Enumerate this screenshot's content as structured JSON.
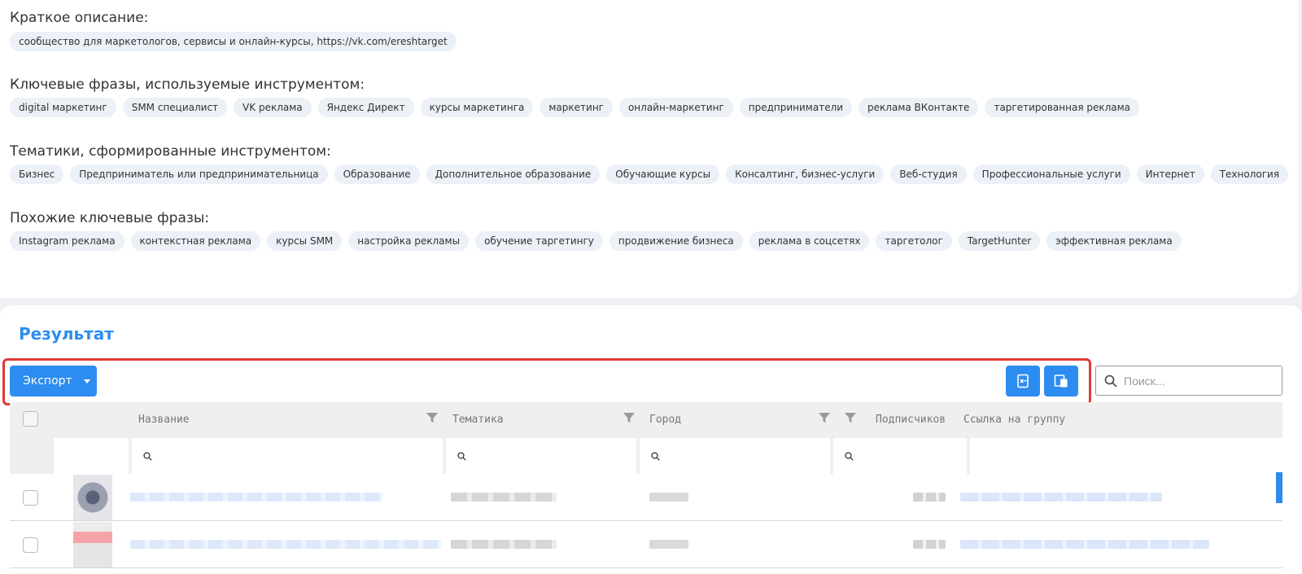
{
  "description": {
    "title": "Краткое описание:",
    "chips": [
      "сообщество для маркетологов, сервисы и онлайн-курсы, https://vk.com/ereshtarget"
    ]
  },
  "keywords": {
    "title": "Ключевые фразы, используемые инструментом:",
    "chips": [
      "digital маркетинг",
      "SMM специалист",
      "VK реклама",
      "Яндекс Директ",
      "курсы маркетинга",
      "маркетинг",
      "онлайн-маркетинг",
      "предприниматели",
      "реклама ВКонтакте",
      "таргетированная реклама"
    ]
  },
  "topics": {
    "title": "Тематики, сформированные инструментом:",
    "chips": [
      "Бизнес",
      "Предприниматель или предпринимательница",
      "Образование",
      "Дополнительное образование",
      "Обучающие курсы",
      "Консалтинг, бизнес-услуги",
      "Веб-студия",
      "Профессиональные услуги",
      "Интернет",
      "Технология"
    ]
  },
  "similar": {
    "title": "Похожие ключевые фразы:",
    "chips": [
      "Instagram реклама",
      "контекстная реклама",
      "курсы SMM",
      "настройка рекламы",
      "обучение таргетингу",
      "продвижение бизнеса",
      "реклама в соцсетях",
      "таргетолог",
      "TargetHunter",
      "эффективная реклама"
    ]
  },
  "result": {
    "title": "Результат",
    "export_label": "Экспорт",
    "xls_icon": "xls-export-icon",
    "copy_icon": "copy-icon",
    "search_placeholder": "Поиск..."
  },
  "table": {
    "columns": [
      "Название",
      "Тематика",
      "Город",
      "Подписчиков",
      "Ссылка на группу"
    ]
  },
  "colors": {
    "accent": "#2d8cf0",
    "highlight": "#e03a35",
    "chip_bg": "#ecf0f7"
  }
}
